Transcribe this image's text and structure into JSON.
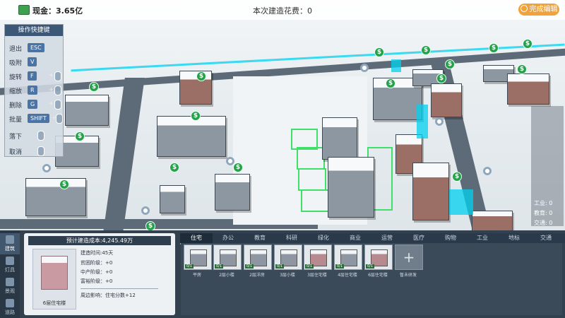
{
  "topbar": {
    "cash": "现金：3.65亿",
    "spend": "本次建造花费：0",
    "finish_button": "完成编辑"
  },
  "hotkeys": {
    "title": "操作快捷键",
    "rows": [
      {
        "label": "退出",
        "key": "ESC"
      },
      {
        "label": "吸附",
        "key": "V"
      },
      {
        "label": "旋转",
        "key": "F"
      },
      {
        "label": "缩放",
        "key": "R"
      },
      {
        "label": "删除",
        "key": "G"
      },
      {
        "label": "批量",
        "key": "SHIFT"
      },
      {
        "label": "落下",
        "key": ""
      },
      {
        "label": "取消",
        "key": ""
      }
    ]
  },
  "right_panel": {
    "rows": [
      "工业: 0",
      "教育: 0",
      "交通: 0"
    ]
  },
  "categories": [
    "住宅",
    "办公",
    "教育",
    "科研",
    "绿化",
    "商业",
    "运营",
    "医疗",
    "购物",
    "工业",
    "地标",
    "交通"
  ],
  "active_category": "住宅",
  "nav": [
    "建筑",
    "灯具",
    "景观",
    "道路"
  ],
  "detail": {
    "cost": "预计建造成本:4,245.49万",
    "preview_name": "6层住宅楼",
    "build_time": "建造时间:45天",
    "poor": "贫困阶级：+0",
    "middle": "中产阶级：+0",
    "rich": "富裕阶级：+0",
    "effect": "周边影响：住宅分数+12"
  },
  "buildings": [
    {
      "label": "平房",
      "badge": "0/1"
    },
    {
      "label": "2层小楼",
      "badge": "0/1"
    },
    {
      "label": "2层洋房",
      "badge": "0/1"
    },
    {
      "label": "3层小楼",
      "badge": "0/1"
    },
    {
      "label": "3层住宅楼",
      "badge": "0/1"
    },
    {
      "label": "4层住宅楼",
      "badge": "0/1"
    },
    {
      "label": "6层住宅楼",
      "badge": "0/1"
    },
    {
      "label": "暂未研发",
      "badge": ""
    }
  ]
}
